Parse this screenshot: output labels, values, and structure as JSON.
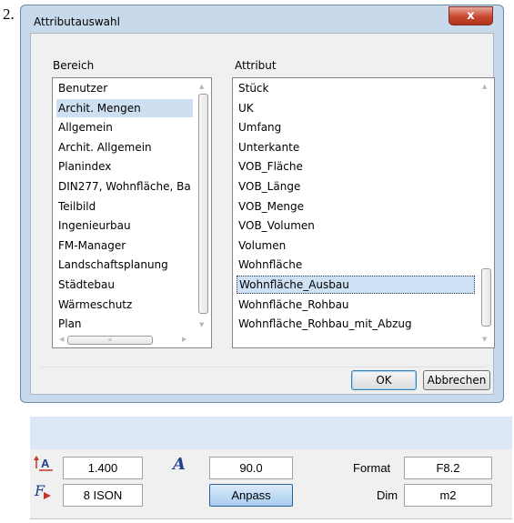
{
  "step_number": "2.",
  "dialog": {
    "title": "Attributauswahl",
    "close_label": "x",
    "bereich_label": "Bereich",
    "attribut_label": "Attribut",
    "bereich_items": [
      "Benutzer",
      "Archit. Mengen",
      "Allgemein",
      "Archit. Allgemein",
      "Planindex",
      "DIN277, Wohnfläche, Ba",
      "Teilbild",
      "Ingenieurbau",
      "FM-Manager",
      "Landschaftsplanung",
      "Städtebau",
      "Wärmeschutz",
      "Plan"
    ],
    "bereich_selected": "Archit. Mengen",
    "attribut_items": [
      "Stück",
      "UK",
      "Umfang",
      "Unterkante",
      "VOB_Fläche",
      "VOB_Länge",
      "VOB_Menge",
      "VOB_Volumen",
      "Volumen",
      "Wohnfläche",
      "Wohnfläche_Ausbau",
      "Wohnfläche_Rohbau",
      "Wohnfläche_Rohbau_mit_Abzug"
    ],
    "attribut_selected": "Wohnfläche_Ausbau",
    "ok_label": "OK",
    "cancel_label": "Abbrechen"
  },
  "toolbar": {
    "text_height_value": "1.400",
    "angle_value": "90.0",
    "format_label": "Format",
    "format_value": "F8.2",
    "font_value": "8 ISON",
    "anpass_label": "Anpass",
    "dim_label": "Dim",
    "dim_value": "m2",
    "text_height_icon": "text-height-icon",
    "angle_icon": "text-angle-icon",
    "font_icon": "font-icon"
  }
}
